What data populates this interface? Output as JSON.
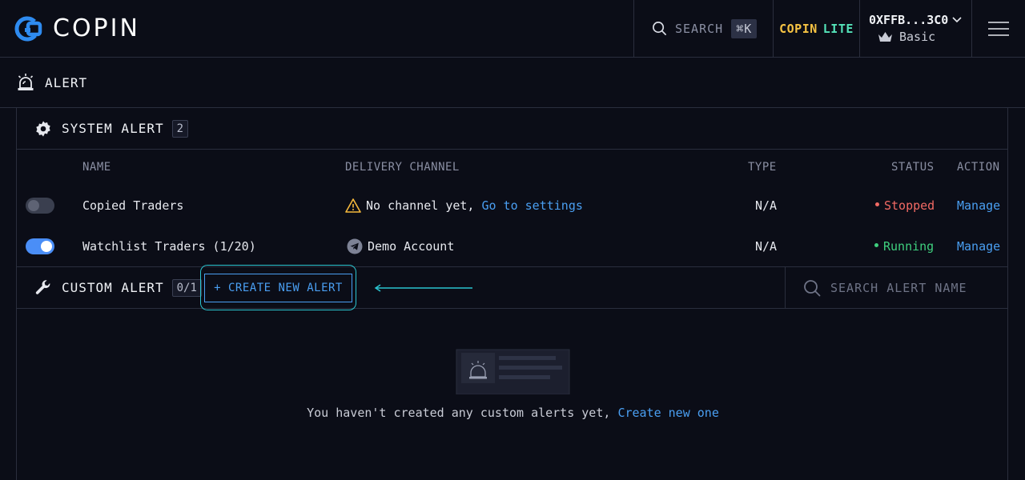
{
  "brand": {
    "name": "COPIN"
  },
  "topbar": {
    "search_label": "SEARCH",
    "search_shortcut": "⌘K",
    "lite_part1": "COPIN",
    "lite_part2": "LITE",
    "account_address": "0XFFB...3C0",
    "account_tier": "Basic"
  },
  "page": {
    "title": "ALERT"
  },
  "system_alert": {
    "title": "SYSTEM ALERT",
    "count": "2",
    "columns": {
      "name": "NAME",
      "delivery": "DELIVERY CHANNEL",
      "type": "TYPE",
      "status": "STATUS",
      "action": "ACTION"
    },
    "rows": [
      {
        "enabled": false,
        "name": "Copied Traders",
        "channel_text": "No channel yet,",
        "channel_link": "Go to settings",
        "type": "N/A",
        "status": "Stopped",
        "action": "Manage"
      },
      {
        "enabled": true,
        "name": "Watchlist Traders (1/20)",
        "channel_text": "Demo Account",
        "type": "N/A",
        "status": "Running",
        "action": "Manage"
      }
    ]
  },
  "custom_alert": {
    "title": "CUSTOM ALERT",
    "count": "0/1",
    "create_button": "+ CREATE NEW ALERT",
    "search_placeholder": "SEARCH ALERT NAME",
    "empty_text": "You haven't created any custom alerts yet,",
    "empty_link": "Create new one"
  },
  "colors": {
    "accent": "#4a9ff2",
    "stopped": "#f26a64",
    "running": "#3fcf7e",
    "highlight": "#2bc4cf"
  }
}
